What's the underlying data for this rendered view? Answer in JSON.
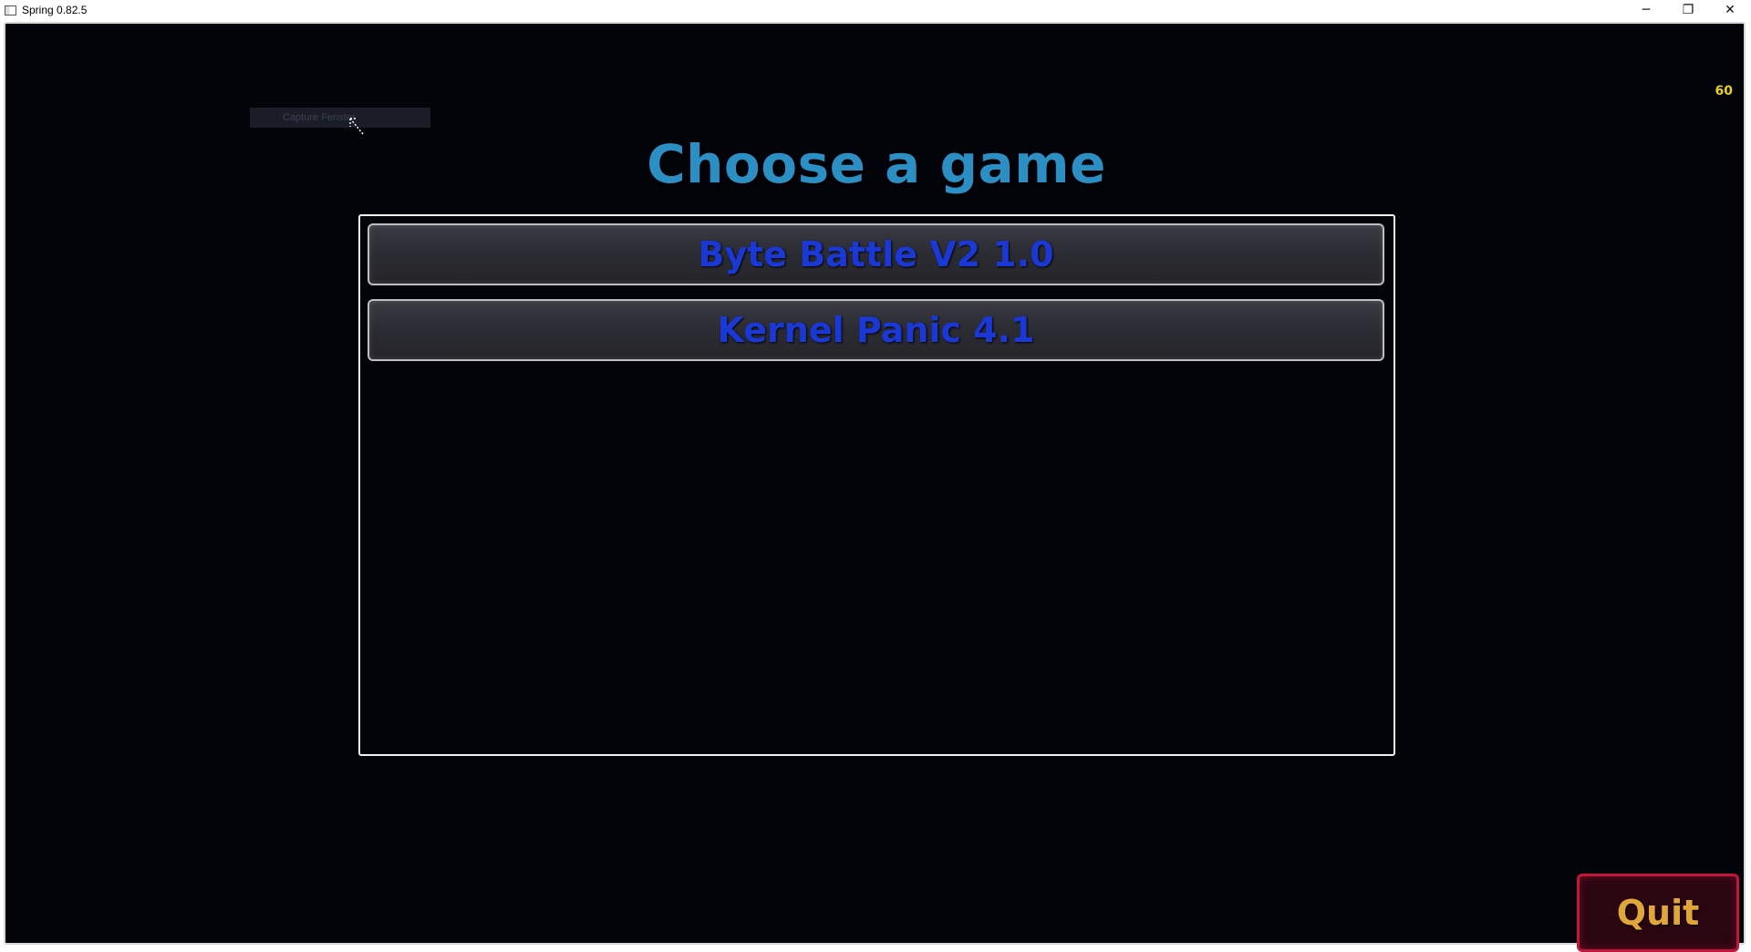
{
  "window": {
    "title": "Spring 0.82.5",
    "controls": {
      "minimize": "─",
      "restore": "❐",
      "close": "✕"
    }
  },
  "overlay": {
    "fps": "60",
    "tooltip": "Capture Fenster"
  },
  "main": {
    "heading": "Choose a game",
    "games": [
      {
        "label": "Byte Battle V2 1.0"
      },
      {
        "label": "Kernel Panic 4.1"
      }
    ]
  },
  "footer": {
    "quit_label": "Quit"
  },
  "colors": {
    "background": "#03030a",
    "heading": "#2b8fc4",
    "game_text": "#1a38d6",
    "quit_text": "#e0a63a",
    "quit_border": "#c2163c",
    "fps": "#e8d21a"
  }
}
